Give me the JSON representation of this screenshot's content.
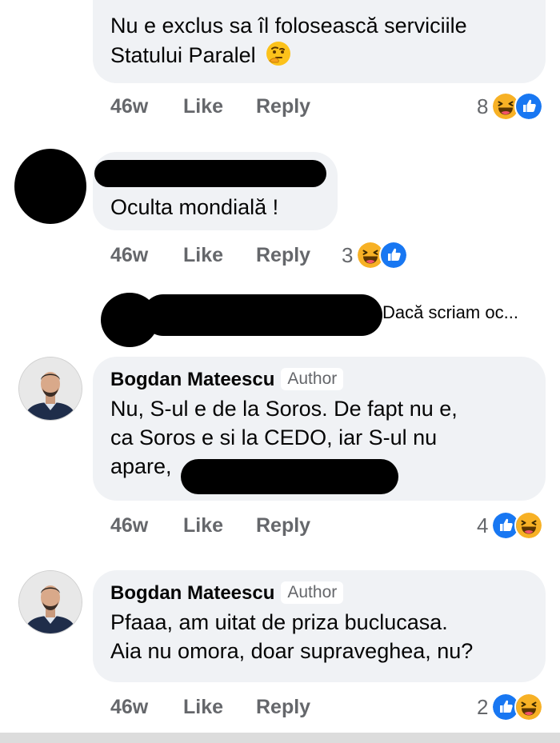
{
  "comments": [
    {
      "text_line1": "Nu e exclus sa îl folosească serviciile",
      "text_line2": "Statului Paralel",
      "emoji": "thinking-face",
      "time": "46w",
      "like": "Like",
      "reply": "Reply",
      "reaction_count": "8",
      "reactions": [
        "haha",
        "like"
      ]
    },
    {
      "text": "Oculta mondială  !",
      "time": "46w",
      "like": "Like",
      "reply": "Reply",
      "reaction_count": "3",
      "reactions": [
        "haha",
        "like"
      ]
    },
    {
      "reply_preview": "Dacă scriam oc..."
    },
    {
      "author": "Bogdan Mateescu",
      "badge": "Author",
      "line1": "Nu, S-ul e de la Soros. De fapt nu e,",
      "line2": "ca Soros e si la CEDO, iar S-ul nu",
      "line3": "apare,",
      "time": "46w",
      "like": "Like",
      "reply": "Reply",
      "reaction_count": "4",
      "reactions": [
        "like",
        "haha"
      ]
    },
    {
      "author": "Bogdan Mateescu",
      "badge": "Author",
      "line1": "Pfaaa, am uitat de priza buclucasa.",
      "line2": "Aia nu omora, doar supraveghea, nu?",
      "time": "46w",
      "like": "Like",
      "reply": "Reply",
      "reaction_count": "2",
      "reactions": [
        "like",
        "haha"
      ]
    }
  ],
  "colors": {
    "like_blue": "#1877f2",
    "haha_yellow": "#f7b125",
    "meta_gray": "#65676b",
    "bubble_bg": "#f0f2f5"
  }
}
